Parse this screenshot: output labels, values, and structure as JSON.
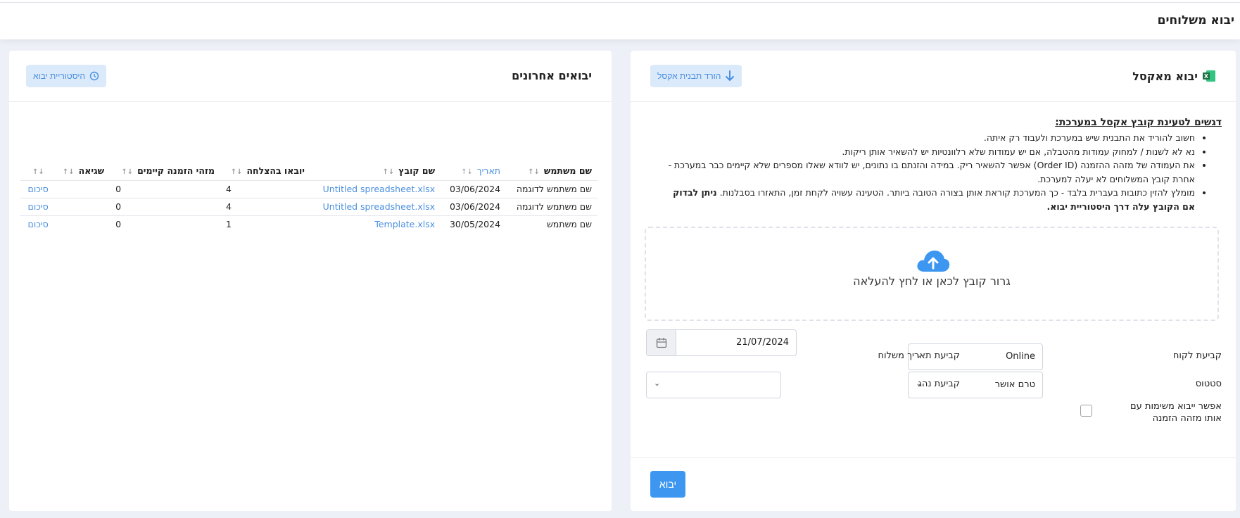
{
  "page": {
    "title": "יבוא משלוחים"
  },
  "import_card": {
    "title": "יבוא מאקסל",
    "download_template_label": "הורד תבנית אקסל",
    "instructions_title": "דגשים לטעינת קובץ אקסל במערכת:",
    "instructions": [
      "חשוב להוריד את התבנית שיש במערכת ולעבוד רק איתה.",
      "נא לא לשנות / למחוק עמודות מהטבלה, אם יש עמודות שלא רלוונטיות יש להשאיר אותן ריקות.",
      "את העמודה של מזהה ההזמנה (Order ID) אפשר להשאיר ריק. במידה והזנתם בו נתונים, יש לוודא שאלו מספרים שלא קיימים כבר במערכת - אחרת קובץ המשלוחים לא יעלה למערכת."
    ],
    "instruction_last_plain": "מומלץ להזין כתובות בעברית בלבד - כך המערכת קוראת אותן בצורה הטובה ביותר. הטעינה עשויה לקחת זמן, התאזרו בסבלנות. ",
    "instruction_last_bold": "ניתן לבדוק אם הקובץ עלה דרך היסטוריית יבוא.",
    "dropzone_text": "גרור קובץ לכאן או לחץ להעלאה",
    "customer_label": "קביעת לקוח",
    "customer_value": "Online",
    "date_label": "קביעת תאריך משלוח",
    "date_value": "21/07/2024",
    "status_label": "סטטוס",
    "status_value": "טרם אושר",
    "driver_label": "קביעת נהג",
    "driver_value": "",
    "allow_duplicates_label_1": "אפשר ייבוא משימות עם",
    "allow_duplicates_label_2": "אותו מזהה הזמנה",
    "submit_label": "יבוא"
  },
  "recent_card": {
    "title": "יבואים אחרונים",
    "history_label": "היסטוריית יבוא",
    "columns": [
      "שם משתמש",
      "תאריך",
      "שם קובץ",
      "יובאו בהצלחה",
      "מזהי הזמנה קיימים",
      "שגיאה",
      ""
    ],
    "rows": [
      {
        "user": "שם משתמש לדוגמה",
        "date": "03/06/2024",
        "file": "Untitled spreadsheet.xlsx",
        "success": "4",
        "existing": "0",
        "error": "",
        "action": "סיכום"
      },
      {
        "user": "שם משתמש לדוגמה",
        "date": "03/06/2024",
        "file": "Untitled spreadsheet.xlsx",
        "success": "4",
        "existing": "0",
        "error": "",
        "action": "סיכום"
      },
      {
        "user": "שם משתמש",
        "date": "30/05/2024",
        "file": "Template.xlsx",
        "success": "1",
        "existing": "0",
        "error": "",
        "action": "סיכום"
      }
    ]
  },
  "colors": {
    "accent": "#3d97f0",
    "soft_accent": "#dbeafb",
    "excel_green": "#1e7145"
  }
}
